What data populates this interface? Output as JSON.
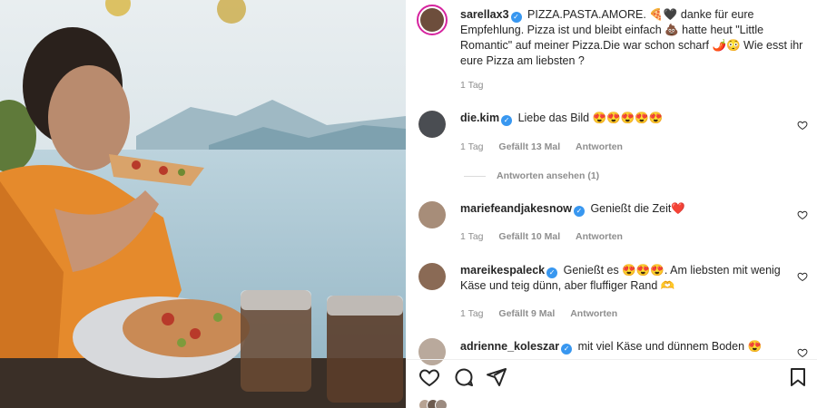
{
  "post": {
    "author": "sarellax3",
    "caption": "PIZZA.PASTA.AMORE. 🍕🖤 danke für eure Empfehlung. Pizza ist und bleibt einfach 💩 hatte heut \"Little Romantic\" auf meiner Pizza.Die war schon scharf 🌶️😳  Wie esst ihr eure Pizza am liebsten ?",
    "time": "1 Tag"
  },
  "comments": [
    {
      "user": "die.kim",
      "verified": true,
      "text": "Liebe das Bild 😍😍😍😍😍",
      "time": "1 Tag",
      "likes": "Gefällt 13 Mal",
      "reply": "Antworten"
    },
    {
      "user": "mariefeandjakesnow",
      "verified": true,
      "text": "Genießt die Zeit❤️",
      "time": "1 Tag",
      "likes": "Gefällt 10 Mal",
      "reply": "Antworten"
    },
    {
      "user": "mareikespaleck",
      "verified": true,
      "text": "Genießt es 😍😍😍. Am liebsten mit wenig Käse und teig dünn, aber fluffiger Rand 🫶",
      "time": "1 Tag",
      "likes": "Gefällt 9 Mal",
      "reply": "Antworten"
    },
    {
      "user": "adrienne_koleszar",
      "verified": true,
      "text": "mit viel Käse und dünnem Boden 😍"
    }
  ],
  "view_replies": "Antworten ansehen (1)",
  "icons": {
    "like": "heart-icon",
    "comment": "comment-icon",
    "share": "share-icon",
    "save": "bookmark-icon"
  },
  "colors": {
    "verified": "#3897f0",
    "muted": "#8e8e8e",
    "text": "#262626",
    "sweater": "#e58a2c",
    "lake": "#a9c6d4"
  }
}
